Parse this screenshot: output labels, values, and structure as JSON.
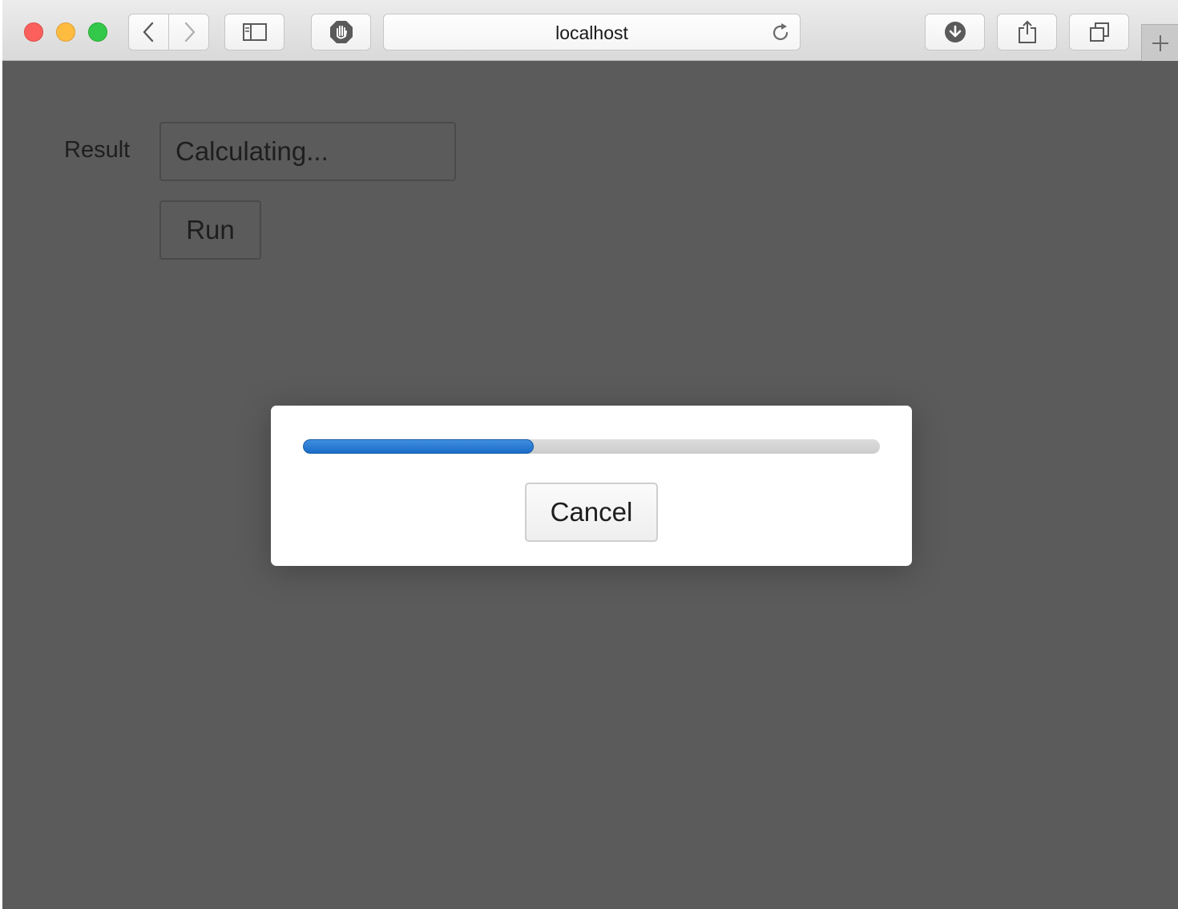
{
  "browser": {
    "url": "localhost",
    "icons": {
      "back": "chevron-left-icon",
      "forward": "chevron-right-icon",
      "sidebar": "sidebar-icon",
      "adblock": "hand-stop-icon",
      "reload": "reload-icon",
      "downloads": "download-icon",
      "share": "share-icon",
      "tabs": "tab-overview-icon",
      "new_tab": "plus-icon"
    }
  },
  "form": {
    "result_label": "Result",
    "result_value": "Calculating...",
    "run_label": "Run"
  },
  "dialog": {
    "progress_fraction": 0.4,
    "cancel_label": "Cancel"
  },
  "colors": {
    "progress": "#1f72d0",
    "overlay": "#5b5b5b"
  }
}
